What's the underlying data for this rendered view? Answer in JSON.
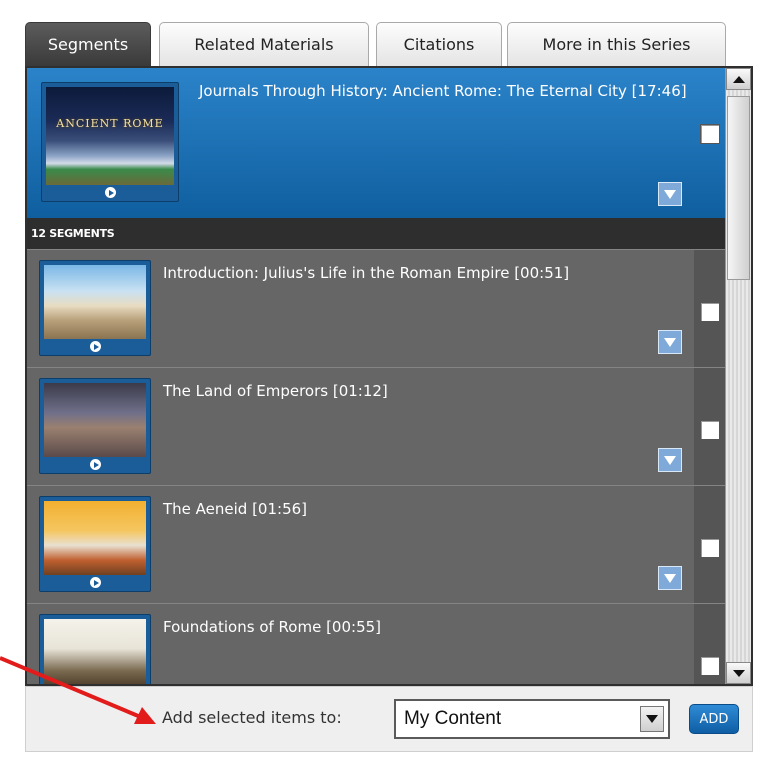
{
  "tabs": [
    {
      "label": "Segments",
      "active": true
    },
    {
      "label": "Related Materials",
      "active": false
    },
    {
      "label": "Citations",
      "active": false
    },
    {
      "label": "More in this Series",
      "active": false
    }
  ],
  "feature": {
    "title": "Journals Through History: Ancient Rome: The Eternal City [17:46]",
    "thumb_text": "ANCIENT ROME"
  },
  "segments_header": "12 SEGMENTS",
  "segments": [
    {
      "title": "Introduction: Julius's Life in the Roman Empire [00:51]"
    },
    {
      "title": "The Land of Emperors [01:12]"
    },
    {
      "title": "The Aeneid [01:56]"
    },
    {
      "title": "Foundations of Rome [00:55]"
    }
  ],
  "bottom": {
    "add_label": "Add selected items to:",
    "select_value": "My Content",
    "add_button": "ADD"
  },
  "colors": {
    "accent_blue": "#1b74bd",
    "panel_gray": "#666666",
    "annotation_arrow": "#e21b1b"
  }
}
